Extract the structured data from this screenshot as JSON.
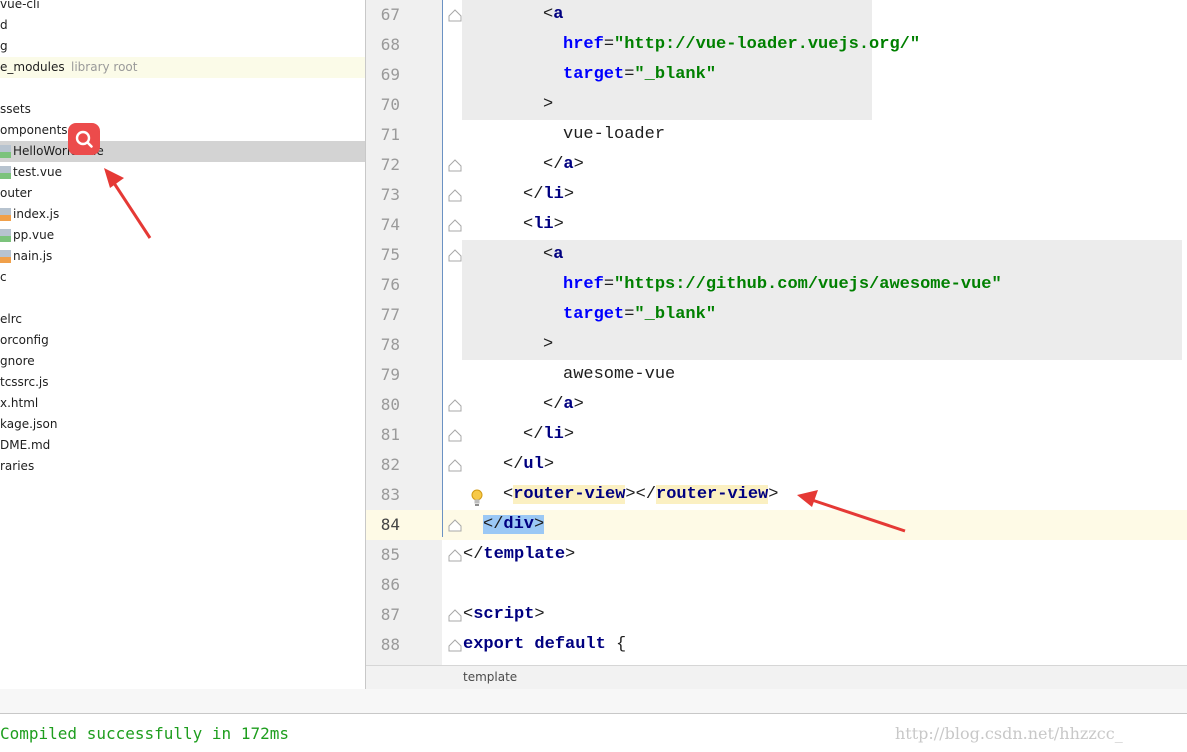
{
  "tree": {
    "items": [
      {
        "label": "vue-cli",
        "muted": "",
        "icon": "folder-icon",
        "selected": false,
        "library": false
      },
      {
        "label": "d",
        "muted": "",
        "icon": "folder-icon",
        "selected": false,
        "library": false
      },
      {
        "label": "g",
        "muted": "",
        "icon": "folder-icon",
        "selected": false,
        "library": false
      },
      {
        "label": "e_modules",
        "muted": "library root",
        "icon": "folder-icon",
        "selected": false,
        "library": true
      },
      {
        "label": "",
        "muted": "",
        "icon": "folder-icon",
        "selected": false,
        "library": false
      },
      {
        "label": "ssets",
        "muted": "",
        "icon": "folder-icon",
        "selected": false,
        "library": false
      },
      {
        "label": "omponents",
        "muted": "",
        "icon": "folder-icon",
        "selected": false,
        "library": false
      },
      {
        "label": "HelloWorld.vue",
        "muted": "",
        "icon": "vue-file-icon",
        "selected": true,
        "library": false
      },
      {
        "label": "test.vue",
        "muted": "",
        "icon": "vue-file-icon",
        "selected": false,
        "library": false
      },
      {
        "label": "outer",
        "muted": "",
        "icon": "folder-icon",
        "selected": false,
        "library": false
      },
      {
        "label": "index.js",
        "muted": "",
        "icon": "js-file-icon",
        "selected": false,
        "library": false
      },
      {
        "label": "pp.vue",
        "muted": "",
        "icon": "vue-file-icon",
        "selected": false,
        "library": false
      },
      {
        "label": "nain.js",
        "muted": "",
        "icon": "js-file-icon",
        "selected": false,
        "library": false
      },
      {
        "label": "c",
        "muted": "",
        "icon": "folder-icon",
        "selected": false,
        "library": false
      },
      {
        "label": "",
        "muted": "",
        "icon": "file-icon",
        "selected": false,
        "library": false
      },
      {
        "label": "elrc",
        "muted": "",
        "icon": "file-icon",
        "selected": false,
        "library": false
      },
      {
        "label": "orconfig",
        "muted": "",
        "icon": "file-icon",
        "selected": false,
        "library": false
      },
      {
        "label": "gnore",
        "muted": "",
        "icon": "file-icon",
        "selected": false,
        "library": false
      },
      {
        "label": "tcssrc.js",
        "muted": "",
        "icon": "file-icon",
        "selected": false,
        "library": false
      },
      {
        "label": "x.html",
        "muted": "",
        "icon": "file-icon",
        "selected": false,
        "library": false
      },
      {
        "label": "kage.json",
        "muted": "",
        "icon": "file-icon",
        "selected": false,
        "library": false
      },
      {
        "label": "DME.md",
        "muted": "",
        "icon": "file-icon",
        "selected": false,
        "library": false
      },
      {
        "label": "raries",
        "muted": "",
        "icon": "file-icon",
        "selected": false,
        "library": false
      }
    ]
  },
  "editor": {
    "lines": [
      {
        "num": "67",
        "tokens": [
          {
            "t": "<",
            "c": "punc"
          },
          {
            "t": "a",
            "c": "tag"
          }
        ]
      },
      {
        "num": "68",
        "tokens": [
          {
            "t": "href",
            "c": "attr"
          },
          {
            "t": "=",
            "c": "punc"
          },
          {
            "t": "\"http://vue-loader.vuejs.org/\"",
            "c": "str"
          }
        ]
      },
      {
        "num": "69",
        "tokens": [
          {
            "t": "target",
            "c": "attr"
          },
          {
            "t": "=",
            "c": "punc"
          },
          {
            "t": "\"_blank\"",
            "c": "str"
          }
        ]
      },
      {
        "num": "70",
        "tokens": [
          {
            "t": ">",
            "c": "punc"
          }
        ]
      },
      {
        "num": "71",
        "tokens": [
          {
            "t": "vue-loader",
            "c": "plain"
          }
        ]
      },
      {
        "num": "72",
        "tokens": [
          {
            "t": "</",
            "c": "punc"
          },
          {
            "t": "a",
            "c": "tag"
          },
          {
            "t": ">",
            "c": "punc"
          }
        ]
      },
      {
        "num": "73",
        "tokens": [
          {
            "t": "</",
            "c": "punc"
          },
          {
            "t": "li",
            "c": "tag"
          },
          {
            "t": ">",
            "c": "punc"
          }
        ]
      },
      {
        "num": "74",
        "tokens": [
          {
            "t": "<",
            "c": "punc"
          },
          {
            "t": "li",
            "c": "tag"
          },
          {
            "t": ">",
            "c": "punc"
          }
        ]
      },
      {
        "num": "75",
        "tokens": [
          {
            "t": "<",
            "c": "punc"
          },
          {
            "t": "a",
            "c": "tag"
          }
        ]
      },
      {
        "num": "76",
        "tokens": [
          {
            "t": "href",
            "c": "attr"
          },
          {
            "t": "=",
            "c": "punc"
          },
          {
            "t": "\"https://github.com/vuejs/awesome-vue\"",
            "c": "str"
          }
        ]
      },
      {
        "num": "77",
        "tokens": [
          {
            "t": "target",
            "c": "attr"
          },
          {
            "t": "=",
            "c": "punc"
          },
          {
            "t": "\"_blank\"",
            "c": "str"
          }
        ]
      },
      {
        "num": "78",
        "tokens": [
          {
            "t": ">",
            "c": "punc"
          }
        ]
      },
      {
        "num": "79",
        "tokens": [
          {
            "t": "awesome-vue",
            "c": "plain"
          }
        ]
      },
      {
        "num": "80",
        "tokens": [
          {
            "t": "</",
            "c": "punc"
          },
          {
            "t": "a",
            "c": "tag"
          },
          {
            "t": ">",
            "c": "punc"
          }
        ]
      },
      {
        "num": "81",
        "tokens": [
          {
            "t": "</",
            "c": "punc"
          },
          {
            "t": "li",
            "c": "tag"
          },
          {
            "t": ">",
            "c": "punc"
          }
        ]
      },
      {
        "num": "82",
        "tokens": [
          {
            "t": "</",
            "c": "punc"
          },
          {
            "t": "ul",
            "c": "tag"
          },
          {
            "t": ">",
            "c": "punc"
          }
        ]
      },
      {
        "num": "83",
        "tokens": [
          {
            "t": "<",
            "c": "punc"
          },
          {
            "t": "router-view",
            "c": "tag"
          },
          {
            "t": "></",
            "c": "punc"
          },
          {
            "t": "router-view",
            "c": "tag"
          },
          {
            "t": ">",
            "c": "punc"
          }
        ]
      },
      {
        "num": "84",
        "tokens": [
          {
            "t": "</",
            "c": "punc"
          },
          {
            "t": "div",
            "c": "tag"
          },
          {
            "t": ">",
            "c": "punc"
          }
        ]
      },
      {
        "num": "85",
        "tokens": [
          {
            "t": "</",
            "c": "punc"
          },
          {
            "t": "template",
            "c": "tag"
          },
          {
            "t": ">",
            "c": "punc"
          }
        ]
      },
      {
        "num": "86",
        "tokens": []
      },
      {
        "num": "87",
        "tokens": [
          {
            "t": "<",
            "c": "punc"
          },
          {
            "t": "script",
            "c": "tag"
          },
          {
            "t": ">",
            "c": "punc"
          }
        ]
      },
      {
        "num": "88",
        "tokens": [
          {
            "t": "export default ",
            "c": "kw"
          },
          {
            "t": "{",
            "c": "punc"
          }
        ]
      }
    ],
    "current_line": "84",
    "breadcrumb": "template"
  },
  "console": {
    "message": "Compiled successfully in 172ms",
    "watermark": "http://blog.csdn.net/hhzzcc_"
  },
  "colors": {
    "annotation_arrow": "#e53935",
    "search_badge": "#ec4b4b",
    "success_text": "#1e9e1e"
  }
}
